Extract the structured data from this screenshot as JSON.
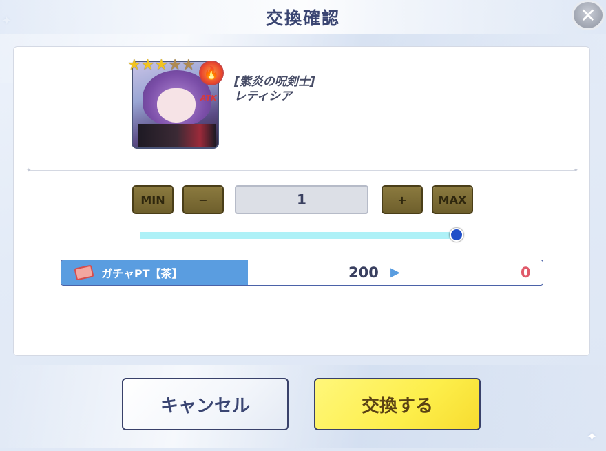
{
  "dialog": {
    "title": "交換確認",
    "close_icon": "close-icon"
  },
  "item": {
    "rarity_stars": 4,
    "max_stars": 5,
    "attribute_icon": "fire-attribute-icon",
    "role_label": "ATK",
    "title": "[紫炎の呪剣士]",
    "name": "レティシア"
  },
  "quantity": {
    "min_label": "MIN",
    "minus_label": "−",
    "value": "1",
    "plus_label": "+",
    "max_label": "MAX",
    "slider_fraction": 1.0
  },
  "cost": {
    "currency_label": "ガチャPT【茶】",
    "currency_icon": "ticket-icon",
    "current": "200",
    "after": "0"
  },
  "buttons": {
    "cancel_label": "キャンセル",
    "confirm_label": "交換する"
  },
  "colors": {
    "accent_blue": "#5a9de0",
    "confirm_yellow": "#fdee4a",
    "qty_button_olive": "#7b6b34",
    "after_value_red": "#e05a6a"
  }
}
